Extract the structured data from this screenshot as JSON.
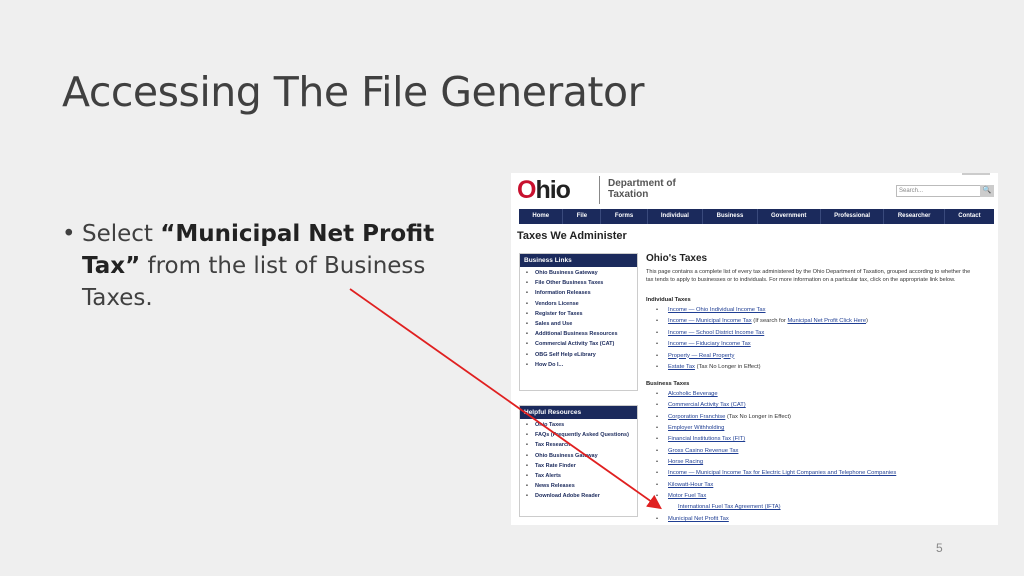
{
  "slide": {
    "title": "Accessing The File Generator",
    "bullet_prefix": "Select ",
    "bullet_bold": "“Municipal Net Profit Tax”",
    "bullet_suffix": " from the list of Business Taxes.",
    "page_number": "5"
  },
  "site": {
    "logo_o": "O",
    "logo_rest": "hio",
    "dept_line1": "Department of",
    "dept_line2": "Taxation",
    "search_placeholder": "Search...",
    "search_icon": "magnifier-icon",
    "nav": [
      "Home",
      "File",
      "Forms",
      "Individual",
      "Business",
      "Government",
      "Professional",
      "Researcher",
      "Contact"
    ],
    "page_heading": "Taxes We Administer",
    "business_links_title": "Business Links",
    "business_links": [
      "Ohio Business Gateway",
      "File Other Business Taxes",
      "Information Releases",
      "Vendors License",
      "Register for Taxes",
      "Sales and Use",
      "Additional Business Resources",
      "Commercial Activity Tax (CAT)",
      "OBG Self Help eLibrary",
      "How Do I..."
    ],
    "helpful_title": "Helpful Resources",
    "helpful_links": [
      "Ohio Taxes",
      "FAQs (Frequently Asked Questions)",
      "Tax Research",
      "Ohio Business Gateway",
      "Tax Rate Finder",
      "Tax Alerts",
      "News Releases",
      "Download Adobe Reader"
    ],
    "ohio_taxes_heading": "Ohio's Taxes",
    "intro": "This page contains a complete list of every tax administered by the Ohio Department of Taxation, grouped according to whether the tax tends to apply to businesses or to individuals. For more information on a particular tax, click on the appropriate link below.",
    "individual_heading": "Individual Taxes",
    "individual_taxes": [
      {
        "link": "Income — Ohio Individual Income Tax",
        "note": ""
      },
      {
        "link": "Income — Municipal Income Tax",
        "note": " (If search for ",
        "link2": "Municipal Net Profit Click Here",
        "note2": ")"
      },
      {
        "link": "Income — School District Income Tax",
        "note": ""
      },
      {
        "link": "Income — Fiduciary Income Tax",
        "note": ""
      },
      {
        "link": "Property — Real Property",
        "note": ""
      },
      {
        "link": "Estate Tax",
        "note": " (Tax No Longer in Effect)"
      }
    ],
    "business_heading": "Business Taxes",
    "business_taxes": [
      {
        "link": "Alcoholic Beverage",
        "note": ""
      },
      {
        "link": "Commercial Activity Tax (CAT)",
        "note": ""
      },
      {
        "link": "Corporation Franchise",
        "note": " (Tax No Longer in Effect)"
      },
      {
        "link": "Employer Withholding",
        "note": ""
      },
      {
        "link": "Financial Institutions Tax (FIT)",
        "note": ""
      },
      {
        "link": "Gross Casino Revenue Tax",
        "note": ""
      },
      {
        "link": "Horse Racing",
        "note": ""
      },
      {
        "link": "Income — Municipal Income Tax for Electric Light Companies and Telephone Companies",
        "note": ""
      },
      {
        "link": "Kilowatt-Hour Tax",
        "note": ""
      },
      {
        "link": "Motor Fuel Tax",
        "note": ""
      },
      {
        "link": "International Fuel Tax Agreement (IFTA)",
        "note": "",
        "sub": true
      },
      {
        "link": "Municipal Net Profit Tax",
        "note": ""
      }
    ]
  },
  "annotation": {
    "arrow_color": "#e02020"
  }
}
